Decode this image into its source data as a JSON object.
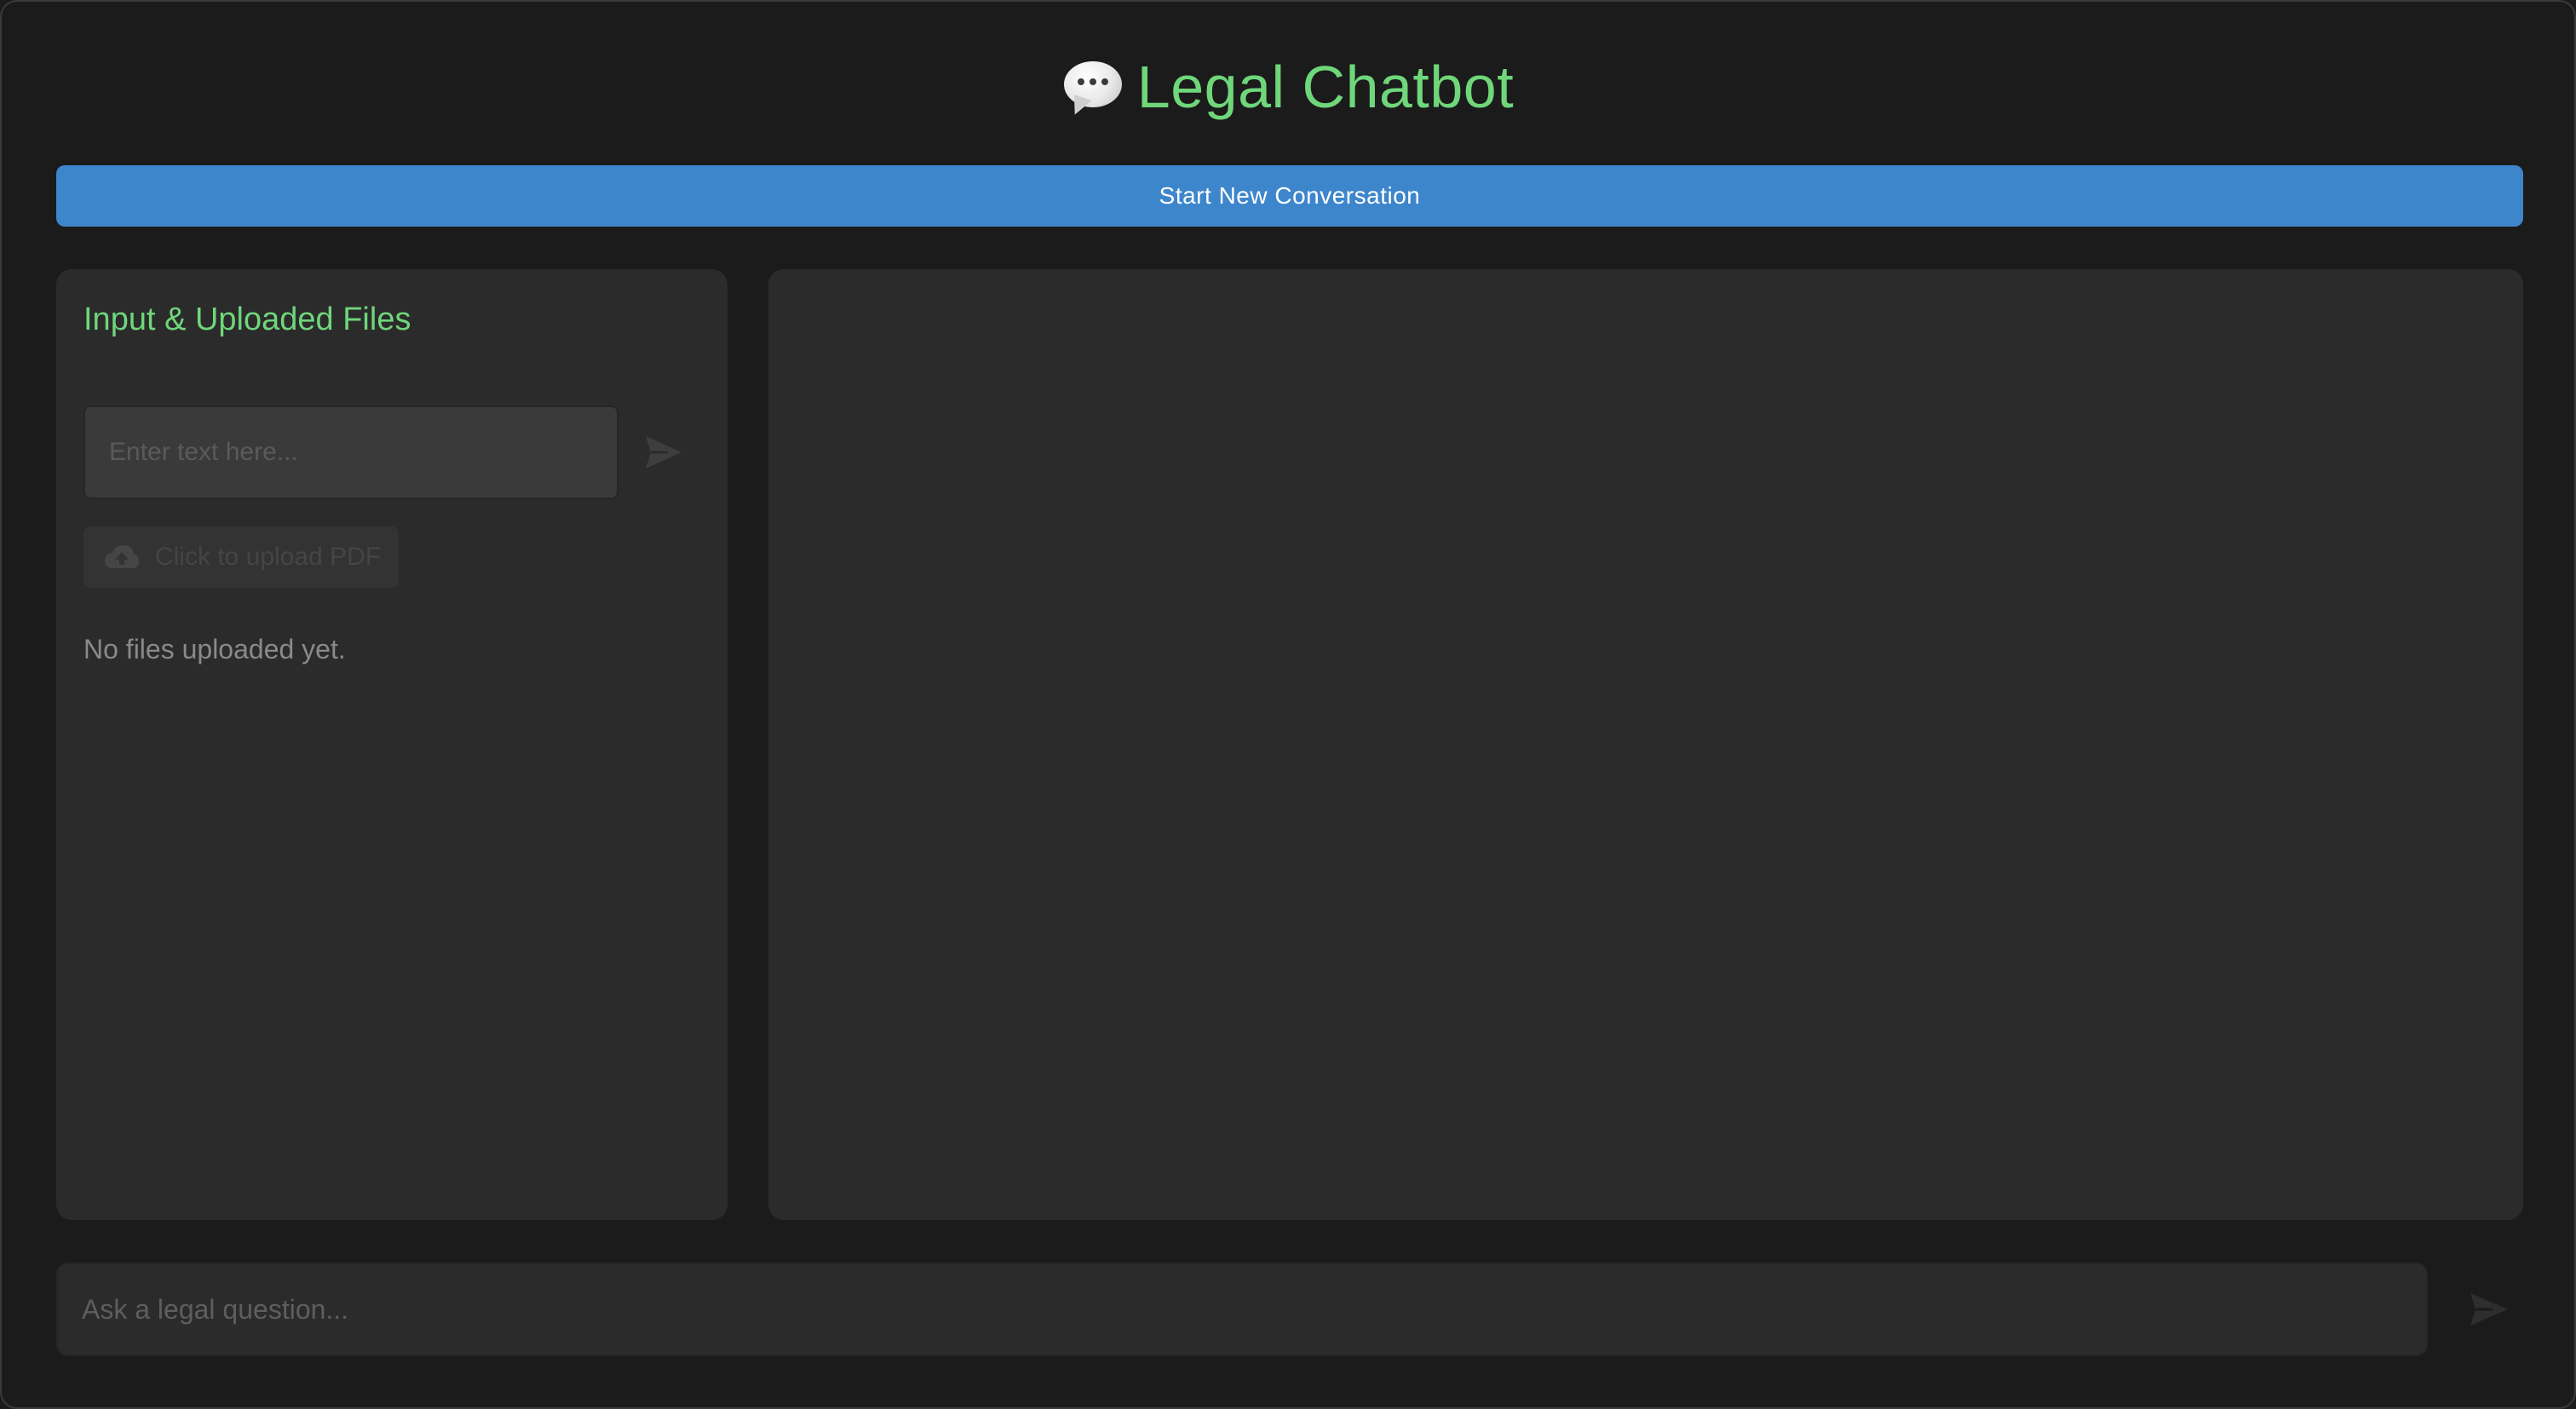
{
  "header": {
    "icon": "speech-bubble-icon",
    "title": "Legal Chatbot"
  },
  "actions": {
    "new_conversation_label": "Start New Conversation"
  },
  "left_panel": {
    "heading": "Input & Uploaded Files",
    "text_input": {
      "value": "",
      "placeholder": "Enter text here..."
    },
    "send_icon": "send-icon",
    "upload": {
      "icon": "cloud-upload-icon",
      "label": "Click to upload PDF"
    },
    "files_status": "No files uploaded yet."
  },
  "chat": {
    "messages": []
  },
  "composer": {
    "value": "",
    "placeholder": "Ask a legal question...",
    "send_icon": "send-icon"
  },
  "colors": {
    "background": "#1b1b1b",
    "panel": "#2b2b2b",
    "accent_green": "#6fd67a",
    "button_blue": "#3d86cc"
  }
}
